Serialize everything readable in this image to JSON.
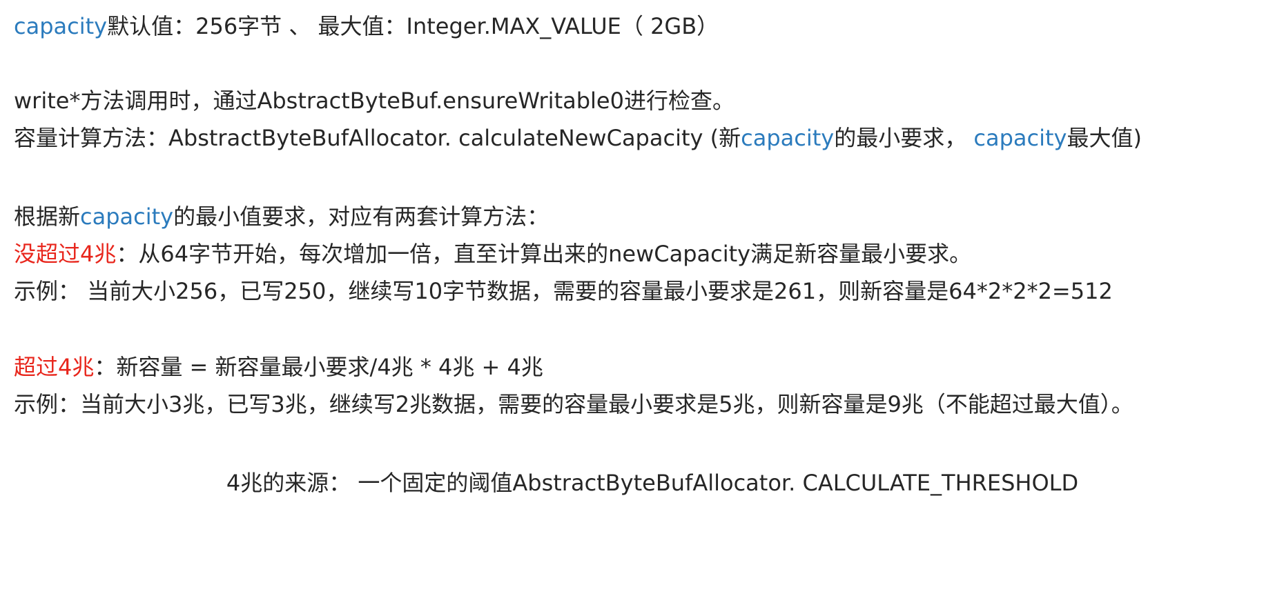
{
  "lines": {
    "l1": {
      "a": "capacity",
      "b": "默认值：256字节 、 最大值：Integer.MAX_VALUE（ 2GB）"
    },
    "l2": {
      "a": "write*方法调用时，通过AbstractByteBuf.ensureWritable0进行检查。"
    },
    "l3": {
      "a": "容量计算方法：AbstractByteBufAllocator. calculateNewCapacity (新",
      "b": "capacity",
      "c": "的最小要求， ",
      "d": "capacity",
      "e": "最大值)"
    },
    "l4": {
      "a": "根据新",
      "b": "capacity",
      "c": "的最小值要求，对应有两套计算方法："
    },
    "l5": {
      "a": "没超过4兆",
      "b": "：从64字节开始，每次增加一倍，直至计算出来的newCapacity满足新容量最小要求。"
    },
    "l6": {
      "a": "示例： 当前大小256，已写250，继续写10字节数据，需要的容量最小要求是261，则新容量是64*2*2*2=512"
    },
    "l7": {
      "a": "超过4兆",
      "b": "：新容量 = 新容量最小要求/4兆 * 4兆 + 4兆"
    },
    "l8": {
      "a": "示例：当前大小3兆，已写3兆，继续写2兆数据，需要的容量最小要求是5兆，则新容量是9兆（不能超过最大值）。"
    },
    "l9": {
      "a": "4兆的来源： 一个固定的阈值AbstractByteBufAllocator. CALCULATE_THRESHOLD"
    }
  },
  "colors": {
    "text": "#262626",
    "keyword_blue": "#2b7bbd",
    "highlight_red": "#e8261c"
  }
}
